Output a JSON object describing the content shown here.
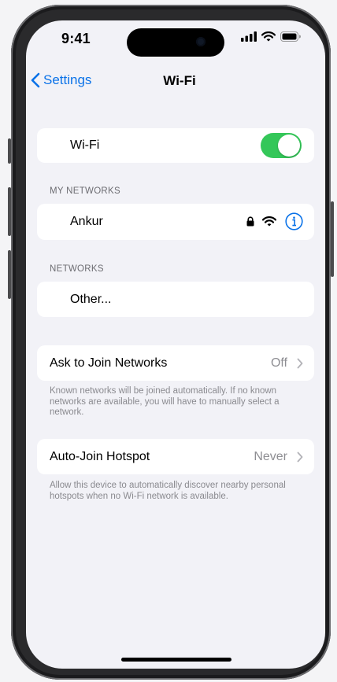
{
  "status_bar": {
    "time": "9:41"
  },
  "nav": {
    "back_label": "Settings",
    "title": "Wi-Fi"
  },
  "wifi_toggle": {
    "label": "Wi-Fi",
    "on": true
  },
  "my_networks": {
    "header": "MY NETWORKS",
    "items": [
      {
        "name": "Ankur",
        "icons": [
          "lock-icon",
          "wifi-icon",
          "info-icon"
        ]
      }
    ]
  },
  "networks": {
    "header": "NETWORKS",
    "other_label": "Other..."
  },
  "ask_to_join": {
    "label": "Ask to Join Networks",
    "value": "Off",
    "footer": "Known networks will be joined automatically. If no known networks are available, you will have to manually select a network."
  },
  "auto_join": {
    "label": "Auto-Join Hotspot",
    "value": "Never",
    "footer": "Allow this device to automatically discover nearby personal hotspots when no Wi-Fi network is available."
  },
  "colors": {
    "accent": "#0a72e8",
    "toggle_on": "#34c759",
    "background": "#f2f2f7"
  }
}
